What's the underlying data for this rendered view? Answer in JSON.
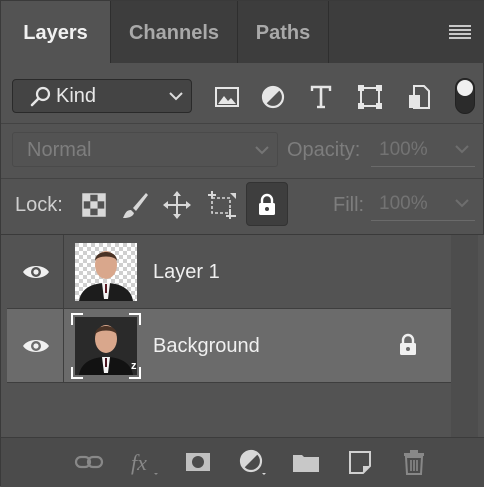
{
  "tabs": [
    {
      "label": "Layers",
      "active": true
    },
    {
      "label": "Channels",
      "active": false
    },
    {
      "label": "Paths",
      "active": false
    }
  ],
  "filter": {
    "kind_label": "Kind",
    "filter_icons": [
      "image-filter-icon",
      "adjustment-filter-icon",
      "type-filter-icon",
      "shape-filter-icon",
      "smart-object-filter-icon"
    ],
    "filter_toggle_on": true
  },
  "blend": {
    "mode": "Normal",
    "opacity_label": "Opacity:",
    "opacity_value": "100%"
  },
  "lock": {
    "label": "Lock:",
    "fill_label": "Fill:",
    "fill_value": "100%",
    "lock_icons": [
      "lock-transparent-pixels-icon",
      "lock-image-pixels-icon",
      "lock-position-icon",
      "lock-artboard-icon",
      "lock-all-icon"
    ],
    "lock_all_active": true
  },
  "layers": [
    {
      "name": "Layer 1",
      "visible": true,
      "selected": false,
      "locked": false
    },
    {
      "name": "Background",
      "visible": true,
      "selected": true,
      "locked": true
    }
  ],
  "bottom_icons": [
    "link-layers-icon",
    "fx-icon",
    "add-mask-icon",
    "adjustment-layer-icon",
    "group-folder-icon",
    "new-layer-icon",
    "trash-icon"
  ],
  "colors": {
    "panel_bg": "#535353",
    "tab_bar_bg": "#3d3d3d",
    "selected_row_bg": "#6b6b6b",
    "text_active": "#f2f2f2",
    "text_dim": "#7d7d7d"
  }
}
